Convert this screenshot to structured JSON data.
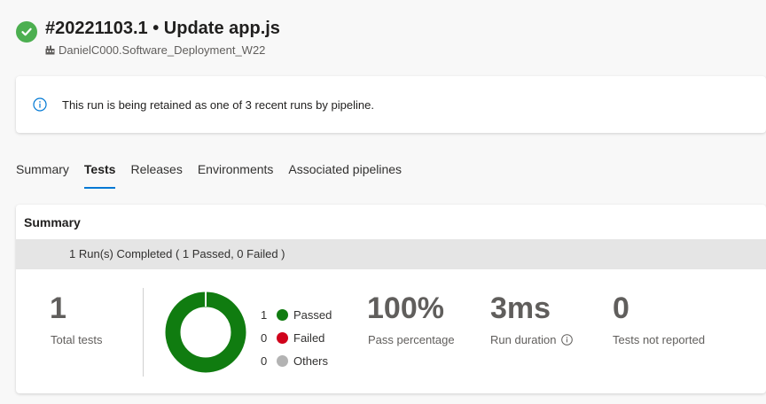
{
  "header": {
    "title": "#20221103.1 • Update app.js",
    "repo": "DanielC000.Software_Deployment_W22",
    "status_color": "#4caf50"
  },
  "banner": {
    "message": "This run is being retained as one of 3 recent runs by pipeline."
  },
  "tabs": [
    {
      "label": "Summary",
      "active": false
    },
    {
      "label": "Tests",
      "active": true
    },
    {
      "label": "Releases",
      "active": false
    },
    {
      "label": "Environments",
      "active": false
    },
    {
      "label": "Associated pipelines",
      "active": false
    }
  ],
  "summary": {
    "title": "Summary",
    "runs_status": "1 Run(s) Completed ( 1 Passed, 0 Failed )",
    "total_tests": {
      "value": "1",
      "label": "Total tests"
    },
    "legend": [
      {
        "count": "1",
        "label": "Passed",
        "color": "#107c10"
      },
      {
        "count": "0",
        "label": "Failed",
        "color": "#d0021b"
      },
      {
        "count": "0",
        "label": "Others",
        "color": "#b3b3b3"
      }
    ],
    "pass_percentage": {
      "value": "100%",
      "label": "Pass percentage"
    },
    "run_duration": {
      "value": "3ms",
      "label": "Run duration"
    },
    "not_reported": {
      "value": "0",
      "label": "Tests not reported"
    }
  },
  "colors": {
    "accent": "#0078d4",
    "passed": "#107c10",
    "failed": "#d0021b",
    "others": "#b3b3b3"
  }
}
